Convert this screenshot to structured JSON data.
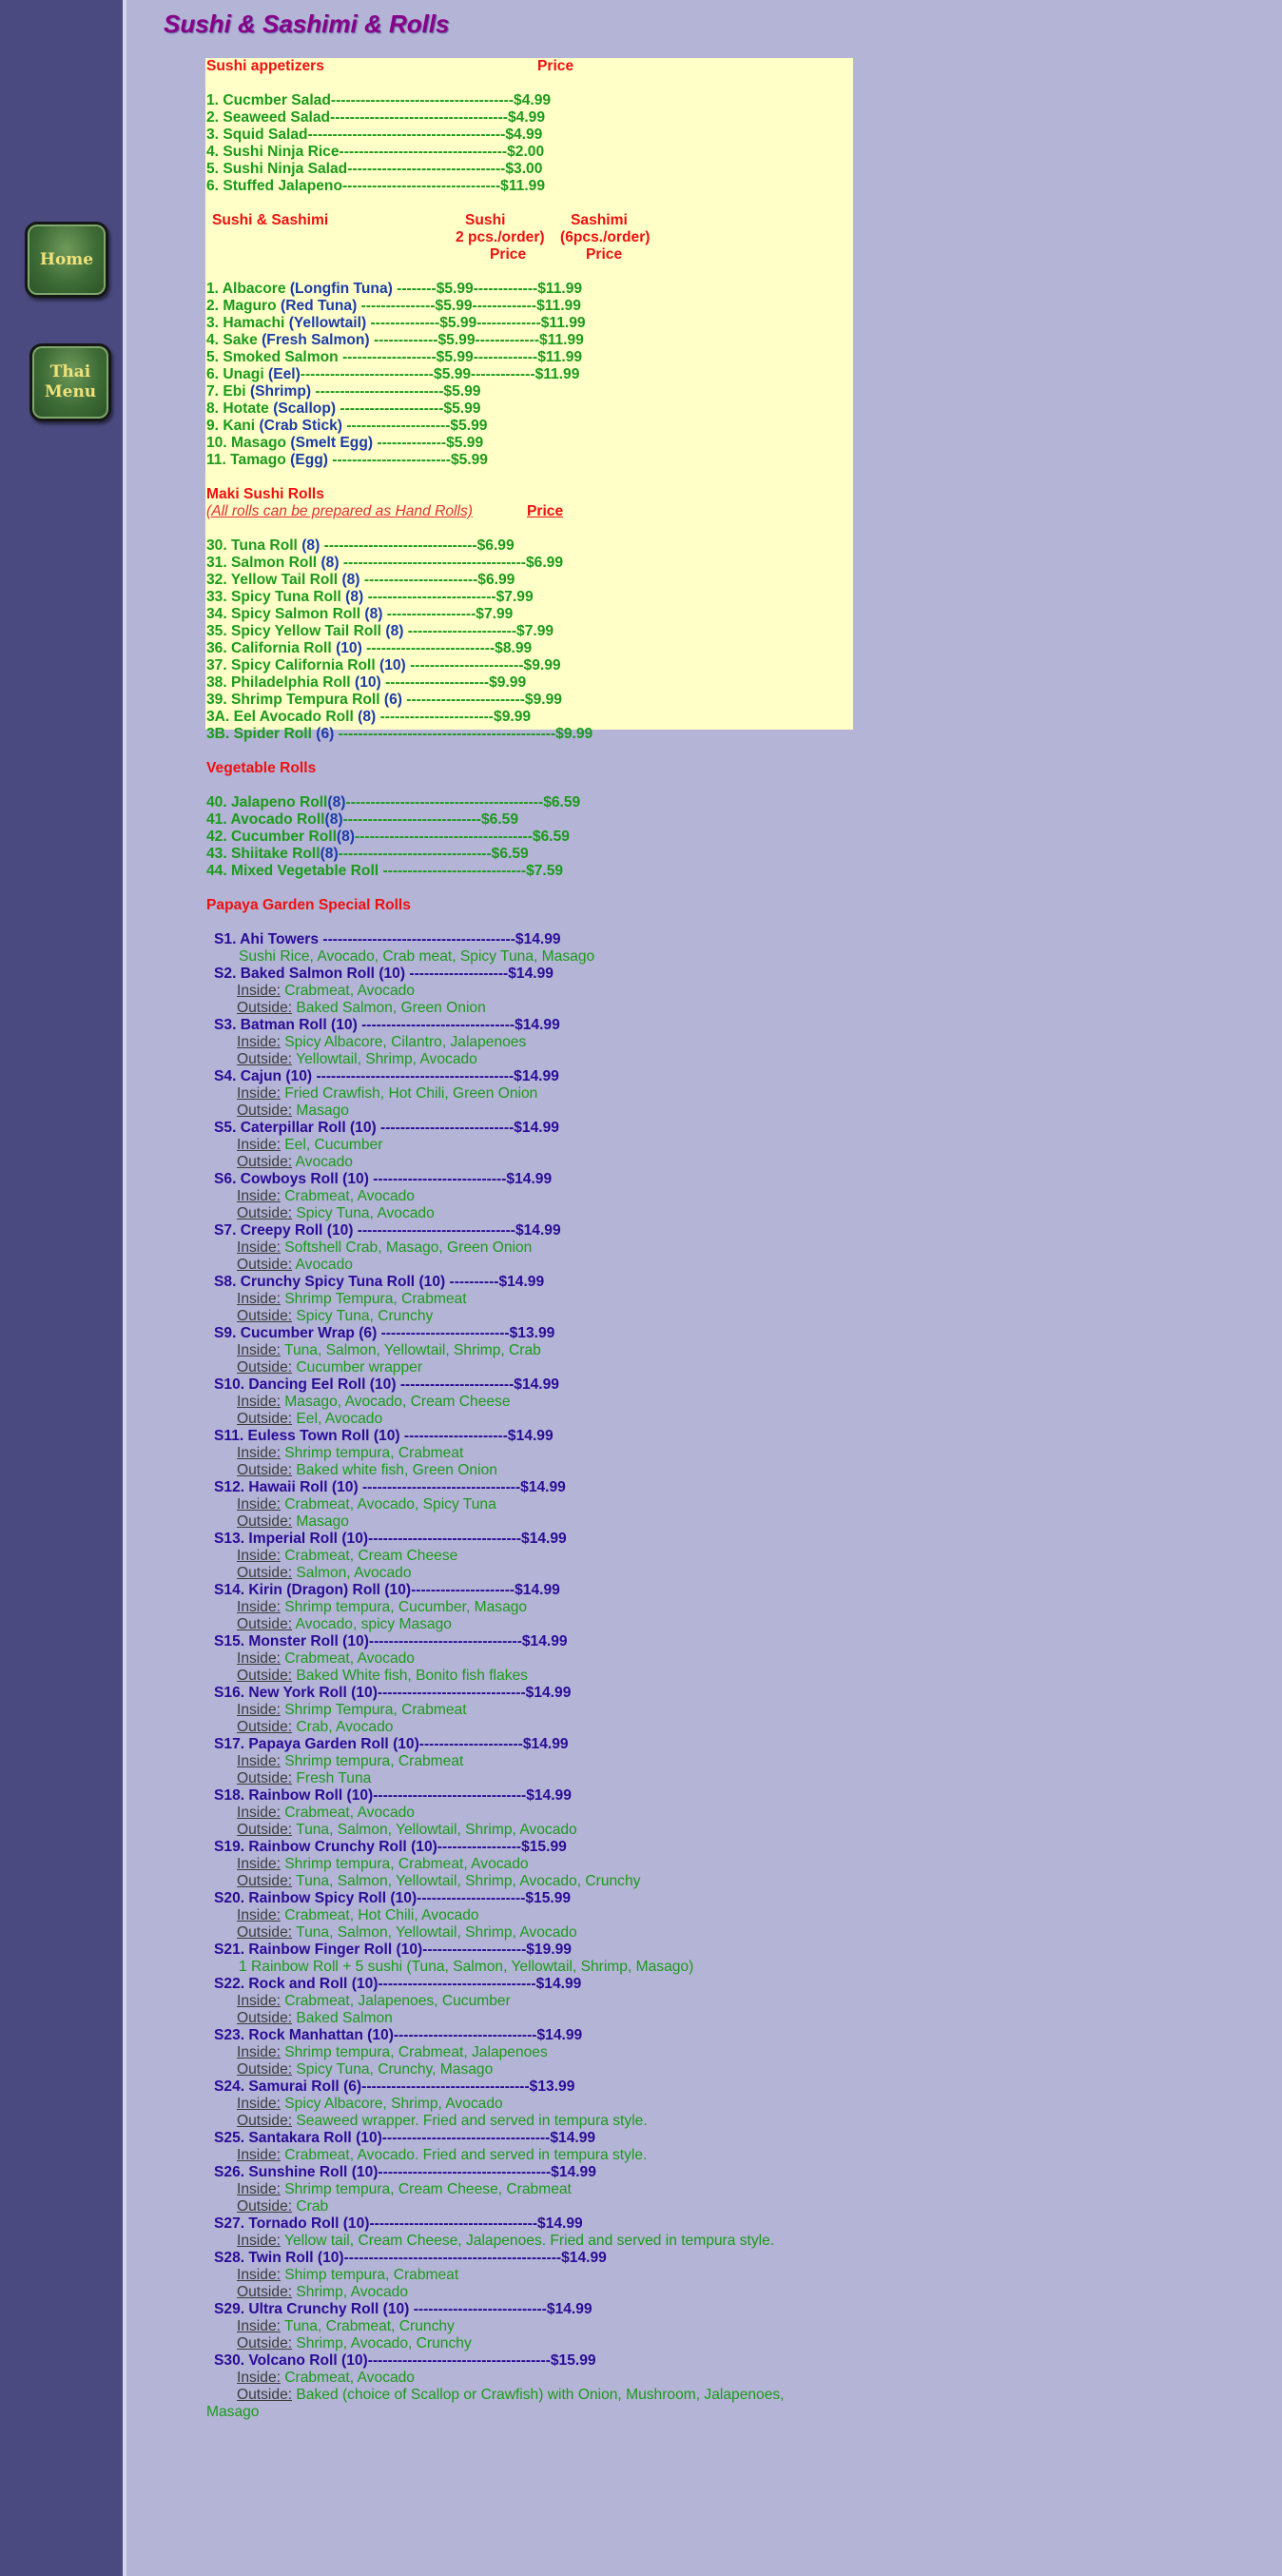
{
  "sidebar": {
    "home_label": "Home",
    "thai_line1": "Thai",
    "thai_line2": "Menu"
  },
  "page_title": "Sushi & Sashimi & Rolls",
  "appetizers": {
    "heading": "Sushi appetizers",
    "price_header": "Price",
    "items": [
      {
        "name": "1. Cucmber Salad",
        "dashes": "-------------------------------------",
        "price": "$4.99"
      },
      {
        "name": "2. Seaweed Salad",
        "dashes": "------------------------------------",
        "price": "$4.99"
      },
      {
        "name": "3. Squid Salad",
        "dashes": "----------------------------------------",
        "price": "$4.99"
      },
      {
        "name": "4. Sushi Ninja Rice",
        "dashes": "----------------------------------",
        "price": "$2.00"
      },
      {
        "name": "5. Sushi Ninja Salad",
        "dashes": "--------------------------------",
        "price": "$3.00"
      },
      {
        "name": "6. Stuffed Jalapeno",
        "dashes": "--------------------------------",
        "price": "$11.99"
      }
    ]
  },
  "sushi_sashimi": {
    "heading": "Sushi & Sashimi",
    "col1_title": "Sushi",
    "col1_sub": "2 pcs./order)",
    "col1_price": "Price",
    "col2_title": "Sashimi",
    "col2_sub": "(6pcs./order)",
    "col2_price": "Price",
    "items": [
      {
        "name": "1. Albacore",
        "alt": "(Longfin Tuna)",
        "dashes": " --------",
        "p1": "$5.99",
        "dashes2": "-------------",
        "p2": "$11.99"
      },
      {
        "name": "2. Maguro",
        "alt": "(Red Tuna)",
        "dashes": " ---------------",
        "p1": "$5.99",
        "dashes2": "-------------",
        "p2": "$11.99"
      },
      {
        "name": "3. Hamachi",
        "alt": "(Yellowtail)",
        "dashes": " --------------",
        "p1": "$5.99",
        "dashes2": "-------------",
        "p2": "$11.99"
      },
      {
        "name": "4. Sake",
        "alt": "(Fresh Salmon)",
        "dashes": " -------------",
        "p1": "$5.99",
        "dashes2": "-------------",
        "p2": "$11.99"
      },
      {
        "name": "5. Smoked Salmon",
        "alt": "",
        "dashes": " -------------------",
        "p1": "$5.99",
        "dashes2": "-------------",
        "p2": "$11.99"
      },
      {
        "name": "6. Unagi",
        "alt": "(Eel)",
        "dashes": "---------------------------",
        "p1": "$5.99",
        "dashes2": "-------------",
        "p2": "$11.99"
      },
      {
        "name": "7. Ebi",
        "alt": "(Shrimp)",
        "dashes": " --------------------------",
        "p1": "$5.99",
        "dashes2": "",
        "p2": ""
      },
      {
        "name": "8. Hotate",
        "alt": "(Scallop)",
        "dashes": " ---------------------",
        "p1": "$5.99",
        "dashes2": "",
        "p2": ""
      },
      {
        "name": "9. Kani",
        "alt": "(Crab Stick)",
        "dashes": " ---------------------",
        "p1": "$5.99",
        "dashes2": "",
        "p2": ""
      },
      {
        "name": "10. Masago",
        "alt": "(Smelt Egg)",
        "dashes": " --------------",
        "p1": "$5.99",
        "dashes2": "",
        "p2": ""
      },
      {
        "name": "11. Tamago",
        "alt": "(Egg)",
        "dashes": " ------------------------",
        "p1": "$5.99",
        "dashes2": "",
        "p2": ""
      }
    ]
  },
  "maki": {
    "heading": "Maki Sushi Rolls",
    "note": "(All rolls can be prepared as Hand Rolls)",
    "price_header": "Price",
    "items": [
      {
        "name": "30. Tuna Roll",
        "pcs": "(8)",
        "dashes": " -------------------------------",
        "price": "$6.99"
      },
      {
        "name": "31. Salmon Roll",
        "pcs": "(8)",
        "dashes": " -------------------------------------",
        "price": "$6.99"
      },
      {
        "name": "32. Yellow Tail Roll",
        "pcs": "(8)",
        "dashes": " -----------------------",
        "price": "$6.99"
      },
      {
        "name": "33. Spicy Tuna Roll",
        "pcs": "(8)",
        "dashes": " --------------------------",
        "price": "$7.99"
      },
      {
        "name": "34. Spicy Salmon Roll",
        "pcs": "(8)",
        "dashes": " ------------------",
        "price": "$7.99"
      },
      {
        "name": "35. Spicy Yellow Tail Roll",
        "pcs": "(8)",
        "dashes": " ----------------------",
        "price": "$7.99"
      },
      {
        "name": "36. California Roll",
        "pcs": "(10)",
        "dashes": " --------------------------",
        "price": "$8.99"
      },
      {
        "name": "37. Spicy California Roll",
        "pcs": "(10)",
        "dashes": " -----------------------",
        "price": "$9.99"
      },
      {
        "name": "38. Philadelphia Roll",
        "pcs": "(10)",
        "dashes": " ---------------------",
        "price": "$9.99"
      },
      {
        "name": "39. Shrimp Tempura Roll",
        "pcs": "(6)",
        "dashes": " ------------------------",
        "price": "$9.99"
      },
      {
        "name": "3A. Eel Avocado Roll",
        "pcs": "(8)",
        "dashes": " -----------------------",
        "price": "$9.99"
      },
      {
        "name": "3B. Spider Roll",
        "pcs": "(6)",
        "dashes": " --------------------------------------------",
        "price": "$9.99"
      }
    ]
  },
  "vegetable": {
    "heading": "Vegetable Rolls",
    "items": [
      {
        "name": "40. Jalapeno Roll",
        "pcs": "(8)",
        "dashes": "----------------------------------------",
        "price": "$6.59"
      },
      {
        "name": "41. Avocado Roll",
        "pcs": "(8)",
        "dashes": "----------------------------",
        "price": "$6.59"
      },
      {
        "name": "42. Cucumber Roll",
        "pcs": "(8)",
        "dashes": "------------------------------------",
        "price": "$6.59"
      },
      {
        "name": "43. Shiitake Roll",
        "pcs": "(8)",
        "dashes": "-------------------------------",
        "price": "$6.59"
      },
      {
        "name": "44. Mixed Vegetable Roll",
        "pcs": "",
        "dashes": " -----------------------------",
        "price": "$7.59"
      }
    ]
  },
  "special": {
    "heading": "Papaya Garden Special Rolls",
    "rolls": [
      {
        "title": "S1. Ahi Towers ---------------------------------------$14.99",
        "lines": [
          {
            "label": "",
            "text": "Sushi Rice, Avocado, Crab meat, Spicy Tuna, Masago"
          }
        ]
      },
      {
        "title": "S2. Baked Salmon Roll (10) --------------------$14.99",
        "lines": [
          {
            "label": "Inside:",
            "text": " Crabmeat, Avocado"
          },
          {
            "label": "Outside:",
            "text": " Baked Salmon, Green Onion"
          }
        ]
      },
      {
        "title": "S3. Batman Roll (10) -------------------------------$14.99",
        "lines": [
          {
            "label": "Inside:",
            "text": " Spicy Albacore, Cilantro, Jalapenoes"
          },
          {
            "label": "Outside:",
            "text": " Yellowtail, Shrimp, Avocado"
          }
        ]
      },
      {
        "title": "S4. Cajun (10) ----------------------------------------$14.99",
        "lines": [
          {
            "label": "Inside:",
            "text": "  Fried Crawfish, Hot Chili, Green Onion"
          },
          {
            "label": "Outside:",
            "text": " Masago"
          }
        ]
      },
      {
        "title": "S5. Caterpillar Roll (10) ---------------------------$14.99",
        "lines": [
          {
            "label": "Inside:",
            "text": "  Eel, Cucumber"
          },
          {
            "label": "Outside:",
            "text": " Avocado"
          }
        ]
      },
      {
        "title": "S6. Cowboys Roll (10) ---------------------------$14.99",
        "lines": [
          {
            "label": "Inside:",
            "text": " Crabmeat, Avocado"
          },
          {
            "label": "Outside:",
            "text": " Spicy Tuna, Avocado"
          }
        ]
      },
      {
        "title": "S7. Creepy Roll (10) --------------------------------$14.99",
        "lines": [
          {
            "label": "Inside:",
            "text": "  Softshell Crab, Masago, Green Onion"
          },
          {
            "label": "Outside:",
            "text": " Avocado"
          }
        ]
      },
      {
        "title": "S8. Crunchy Spicy Tuna Roll (10) ----------$14.99",
        "lines": [
          {
            "label": "Inside:",
            "text": " Shrimp Tempura, Crabmeat"
          },
          {
            "label": "Outside:",
            "text": " Spicy Tuna, Crunchy"
          }
        ]
      },
      {
        "title": "S9. Cucumber Wrap (6) --------------------------$13.99",
        "lines": [
          {
            "label": "Inside:",
            "text": " Tuna, Salmon, Yellowtail, Shrimp, Crab"
          },
          {
            "label": "Outside:",
            "text": " Cucumber wrapper"
          }
        ]
      },
      {
        "title": "S10. Dancing Eel Roll (10) -----------------------$14.99",
        "lines": [
          {
            "label": "Inside:",
            "text": " Masago, Avocado, Cream Cheese"
          },
          {
            "label": "Outside:",
            "text": " Eel, Avocado"
          }
        ]
      },
      {
        "title": "S11. Euless Town Roll (10) ---------------------$14.99",
        "lines": [
          {
            "label": "Inside:",
            "text": " Shrimp tempura, Crabmeat"
          },
          {
            "label": "Outside:",
            "text": " Baked white fish, Green Onion"
          }
        ]
      },
      {
        "title": "S12. Hawaii Roll (10) --------------------------------$14.99",
        "lines": [
          {
            "label": "Inside:",
            "text": " Crabmeat, Avocado, Spicy Tuna"
          },
          {
            "label": "Outside:",
            "text": " Masago"
          }
        ]
      },
      {
        "title": "S13. Imperial Roll (10)-------------------------------$14.99",
        "lines": [
          {
            "label": "Inside:",
            "text": " Crabmeat, Cream Cheese"
          },
          {
            "label": "Outside:",
            "text": " Salmon, Avocado"
          }
        ]
      },
      {
        "title": "S14. Kirin (Dragon) Roll (10)---------------------$14.99",
        "lines": [
          {
            "label": "Inside:",
            "text": "  Shrimp tempura, Cucumber, Masago"
          },
          {
            "label": "Outside:",
            "text": " Avocado, spicy Masago"
          }
        ]
      },
      {
        "title": "S15. Monster Roll (10)-------------------------------$14.99",
        "lines": [
          {
            "label": "Inside:",
            "text": "  Crabmeat, Avocado"
          },
          {
            "label": "Outside:",
            "text": " Baked White fish, Bonito fish flakes"
          }
        ]
      },
      {
        "title": "S16. New York Roll (10)------------------------------$14.99",
        "lines": [
          {
            "label": "Inside:",
            "text": "  Shrimp Tempura, Crabmeat"
          },
          {
            "label": "Outside:",
            "text": " Crab, Avocado"
          }
        ]
      },
      {
        "title": "S17. Papaya Garden Roll (10)---------------------$14.99",
        "lines": [
          {
            "label": "Inside:",
            "text": " Shrimp tempura, Crabmeat"
          },
          {
            "label": "Outside:",
            "text": " Fresh Tuna"
          }
        ]
      },
      {
        "title": "S18. Rainbow Roll (10)-------------------------------$14.99",
        "lines": [
          {
            "label": "Inside:",
            "text": " Crabmeat, Avocado"
          },
          {
            "label": "Outside:",
            "text": " Tuna, Salmon, Yellowtail, Shrimp, Avocado"
          }
        ]
      },
      {
        "title": "S19. Rainbow Crunchy Roll (10)-----------------$15.99",
        "lines": [
          {
            "label": "Inside:",
            "text": " Shrimp tempura, Crabmeat, Avocado"
          },
          {
            "label": "Outside:",
            "text": " Tuna, Salmon, Yellowtail, Shrimp, Avocado, Crunchy"
          }
        ]
      },
      {
        "title": "S20. Rainbow Spicy Roll (10)----------------------$15.99",
        "lines": [
          {
            "label": "Inside:",
            "text": " Crabmeat, Hot Chili, Avocado"
          },
          {
            "label": "Outside:",
            "text": " Tuna, Salmon, Yellowtail, Shrimp, Avocado"
          }
        ]
      },
      {
        "title": "S21. Rainbow Finger Roll (10)---------------------$19.99",
        "lines": [
          {
            "label": "",
            "text": "1 Rainbow Roll + 5 sushi (Tuna, Salmon, Yellowtail, Shrimp, Masago)"
          }
        ]
      },
      {
        "title": "S22. Rock and Roll (10)--------------------------------$14.99",
        "lines": [
          {
            "label": "Inside:",
            "text": " Crabmeat, Jalapenoes, Cucumber"
          },
          {
            "label": "Outside:",
            "text": " Baked Salmon"
          }
        ]
      },
      {
        "title": "S23. Rock Manhattan (10)-----------------------------$14.99",
        "lines": [
          {
            "label": "Inside:",
            "text": " Shrimp tempura, Crabmeat, Jalapenoes"
          },
          {
            "label": "Outside:",
            "text": " Spicy Tuna, Crunchy, Masago"
          }
        ]
      },
      {
        "title": "S24. Samurai Roll (6)----------------------------------$13.99",
        "lines": [
          {
            "label": "Inside:",
            "text": " Spicy Albacore, Shrimp, Avocado"
          },
          {
            "label": "Outside:",
            "text": " Seaweed wrapper. Fried and served in tempura style."
          }
        ]
      },
      {
        "title": "S25. Santakara Roll (10)----------------------------------$14.99",
        "lines": [
          {
            "label": "Inside:",
            "text": " Crabmeat, Avocado. Fried and served in tempura style."
          }
        ]
      },
      {
        "title": "S26. Sunshine Roll (10)-----------------------------------$14.99",
        "lines": [
          {
            "label": "Inside:",
            "text": " Shrimp tempura, Cream Cheese, Crabmeat"
          },
          {
            "label": "Outside:",
            "text": " Crab"
          }
        ]
      },
      {
        "title": "S27. Tornado Roll (10)----------------------------------$14.99",
        "lines": [
          {
            "label": "Inside:",
            "text": " Yellow tail, Cream Cheese, Jalapenoes. Fried and served in tempura style."
          }
        ]
      },
      {
        "title": "S28. Twin Roll (10)--------------------------------------------$14.99",
        "lines": [
          {
            "label": "Inside:",
            "text": " Shimp tempura, Crabmeat"
          },
          {
            "label": "Outside:",
            "text": " Shrimp, Avocado"
          }
        ]
      },
      {
        "title": "S29. Ultra Crunchy Roll (10) ---------------------------$14.99",
        "lines": [
          {
            "label": "Inside:",
            "text": " Tuna, Crabmeat, Crunchy"
          },
          {
            "label": "Outside:",
            "text": " Shrimp, Avocado, Crunchy"
          }
        ]
      },
      {
        "title": "S30. Volcano Roll (10)-------------------------------------$15.99",
        "lines": [
          {
            "label": "Inside:",
            "text": " Crabmeat, Avocado"
          },
          {
            "label": "Outside:",
            "text": " Baked (choice of Scallop or Crawfish) with Onion, Mushroom, Jalapenoes,"
          }
        ]
      },
      {
        "title": "",
        "lines": [
          {
            "label": "",
            "text": "Masago"
          }
        ]
      }
    ]
  }
}
